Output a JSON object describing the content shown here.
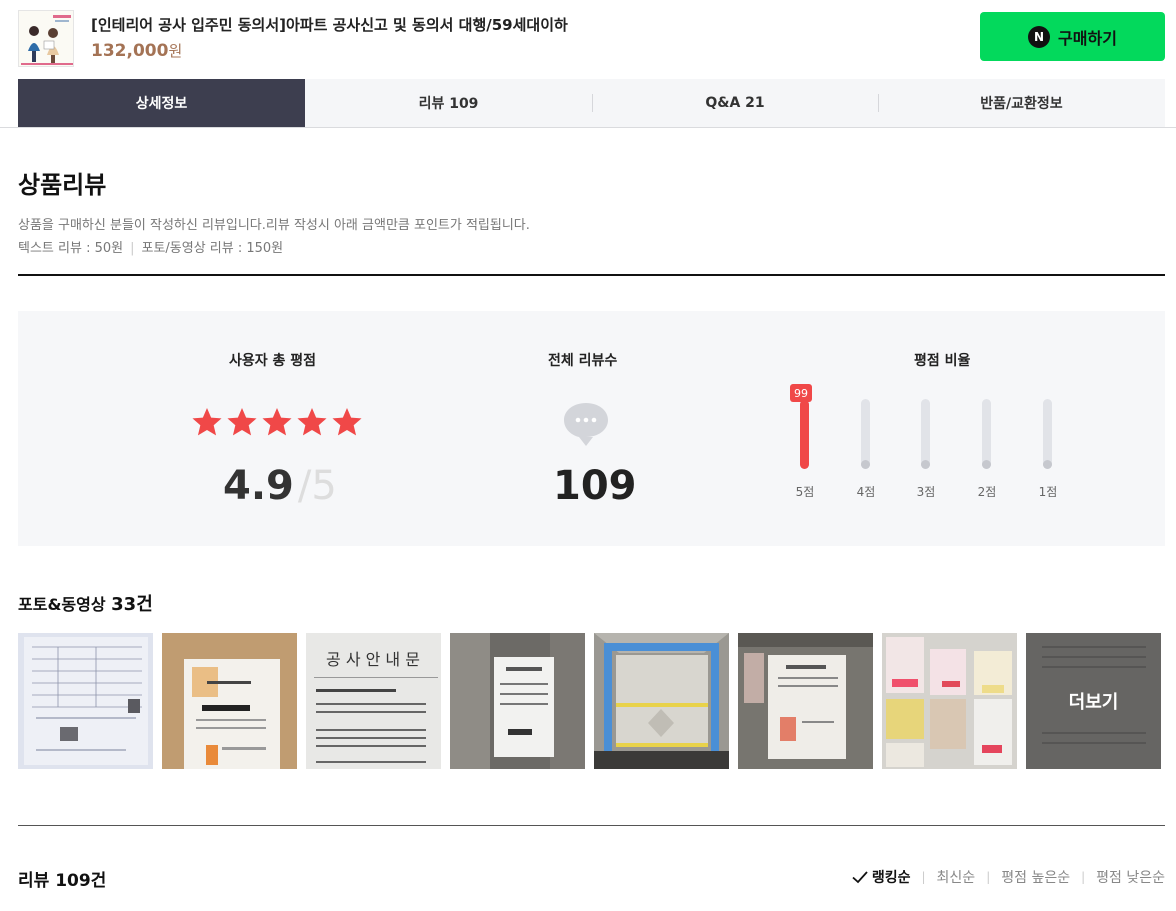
{
  "header": {
    "product_title": "[인테리어 공사 입주민 동의서]아파트 공사신고 및 동의서 대행/59세대이하",
    "price": "132,000",
    "price_unit": "원",
    "buy_button": "구매하기",
    "buy_logo": "N"
  },
  "tabs": [
    {
      "label": "상세정보",
      "active": true
    },
    {
      "label": "리뷰 109",
      "active": false
    },
    {
      "label": "Q&A 21",
      "active": false
    },
    {
      "label": "반품/교환정보",
      "active": false
    }
  ],
  "review_section": {
    "title": "상품리뷰",
    "description": "상품을 구매하신 분들이 작성하신 리뷰입니다.리뷰 작성시 아래 금액만큼 포인트가 적립됩니다.",
    "text_review_point": "텍스트 리뷰 : 50원",
    "photo_review_point": "포토/동영상 리뷰 : 150원"
  },
  "summary": {
    "rating_title": "사용자 총 평점",
    "rating": "4.9",
    "rating_max": "/5",
    "stars_filled": 5,
    "count_title": "전체 리뷰수",
    "count": "109",
    "ratio_title": "평점 비율",
    "ratio": [
      {
        "label": "5점",
        "percent": 99,
        "badge": "99"
      },
      {
        "label": "4점",
        "percent": 0
      },
      {
        "label": "3점",
        "percent": 0
      },
      {
        "label": "2점",
        "percent": 0
      },
      {
        "label": "1점",
        "percent": 0
      }
    ],
    "accent_color": "#f04848"
  },
  "photos": {
    "title": "포토&동영상",
    "count": "33건",
    "more_label": "더보기"
  },
  "reviews": {
    "count_label": "리뷰 109건",
    "sort_options": [
      {
        "label": "랭킹순",
        "active": true
      },
      {
        "label": "최신순",
        "active": false
      },
      {
        "label": "평점 높은순",
        "active": false
      },
      {
        "label": "평점 낮은순",
        "active": false
      }
    ]
  },
  "colors": {
    "buy_button": "#03d95c",
    "active_tab": "#3d3e4f",
    "price": "#a47355"
  }
}
